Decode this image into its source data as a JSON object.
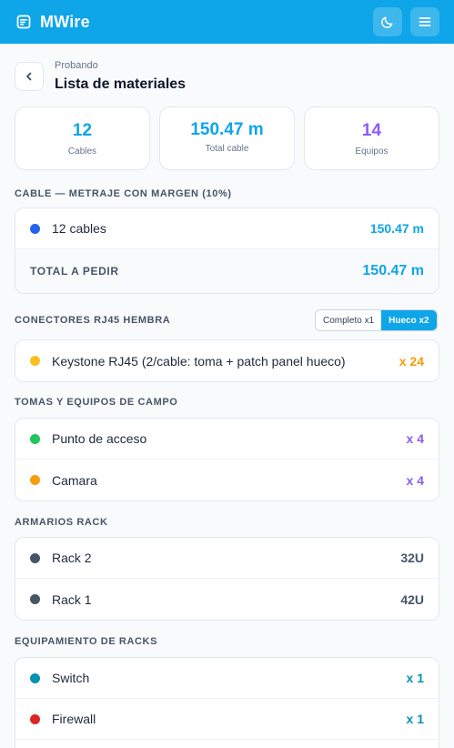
{
  "app": {
    "title": "MWire"
  },
  "page": {
    "breadcrumb": "Probando",
    "title": "Lista de materiales"
  },
  "stats": [
    {
      "value": "12",
      "label": "Cables",
      "color": "#0ea5e9"
    },
    {
      "value": "150.47 m",
      "label": "Total cable",
      "color": "#0ea5e9"
    },
    {
      "value": "14",
      "label": "Equipos",
      "color": "#8b5cf6"
    }
  ],
  "cable": {
    "title": "CABLE — METRAJE CON MARGEN (10%)",
    "row": {
      "label": "12 cables",
      "value": "150.47 m",
      "dot": "#2563eb"
    },
    "total_label": "TOTAL A PEDIR",
    "total_value": "150.47 m"
  },
  "connectors": {
    "title": "CONECTORES RJ45 HEMBRA",
    "toggle": {
      "options": [
        "Completo x1",
        "Hueco x2"
      ],
      "selected": "Hueco x2"
    },
    "row": {
      "label": "Keystone RJ45 (2/cable: toma + patch panel hueco)",
      "value": "x 24",
      "dot": "#fbbf24",
      "value_color": "#f59e0b"
    }
  },
  "field": {
    "title": "TOMAS Y EQUIPOS DE CAMPO",
    "rows": [
      {
        "label": "Punto de acceso",
        "value": "x 4",
        "dot": "#22c55e"
      },
      {
        "label": "Camara",
        "value": "x 4",
        "dot": "#f59e0b"
      }
    ],
    "value_color": "#8b5cf6"
  },
  "racks": {
    "title": "ARMARIOS RACK",
    "rows": [
      {
        "label": "Rack 2",
        "value": "32U",
        "dot": "#475569"
      },
      {
        "label": "Rack 1",
        "value": "42U",
        "dot": "#475569"
      }
    ],
    "value_color": "#475569"
  },
  "rack_equipment": {
    "title": "EQUIPAMIENTO DE RACKS",
    "rows": [
      {
        "label": "Switch",
        "value": "x 1",
        "dot": "#0891b2"
      },
      {
        "label": "Firewall",
        "value": "x 1",
        "dot": "#dc2626"
      }
    ],
    "value_color": "#0891b2"
  },
  "icons": {
    "brand": "document-icon",
    "theme": "moon-icon",
    "menu": "hamburger-menu-icon",
    "back": "chevron-left-icon"
  }
}
